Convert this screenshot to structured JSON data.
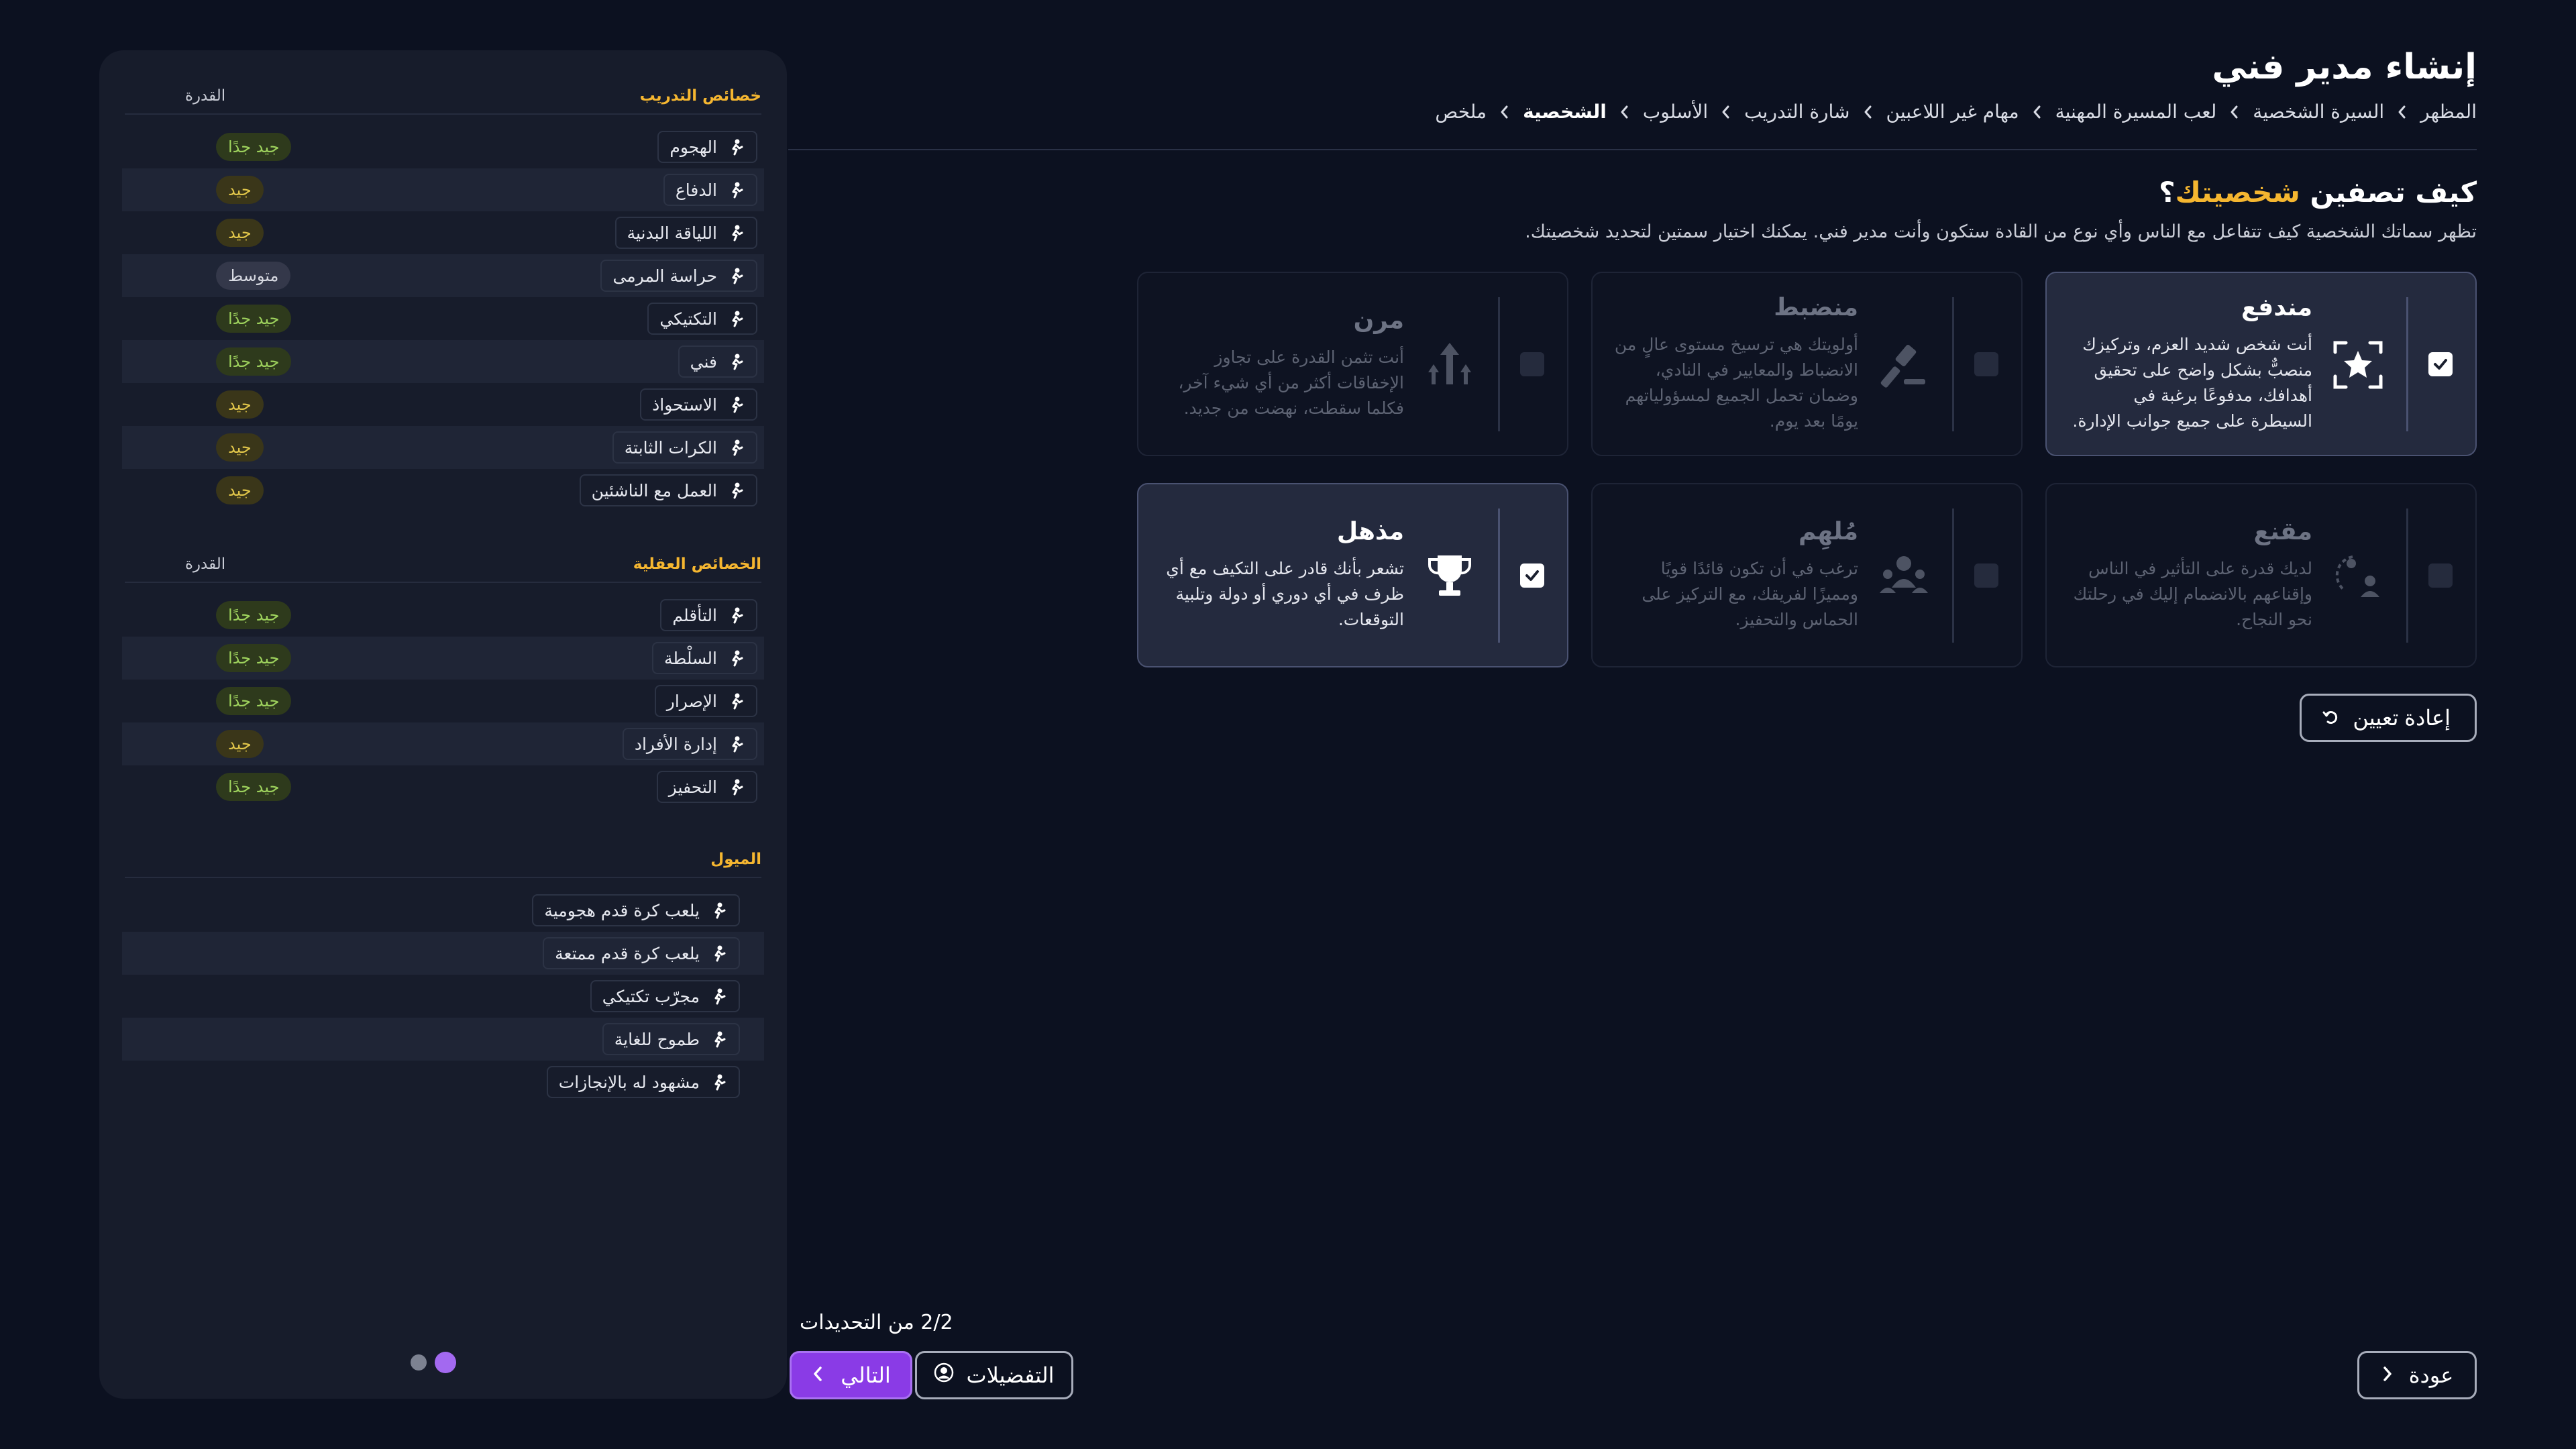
{
  "header": {
    "title": "إنشاء مدير فني",
    "breadcrumb": [
      "المظهر",
      "السيرة الشخصية",
      "لعب المسيرة المهنية",
      "مهام غير اللاعبين",
      "شارة التدريب",
      "الأسلوب",
      "الشخصية",
      "ملخص"
    ],
    "active_crumb": "الشخصية"
  },
  "question": {
    "prefix": "كيف تصفين ",
    "highlight": "شخصيتك",
    "suffix": "؟",
    "subtitle": "تظهر سماتك الشخصية كيف تتفاعل مع الناس وأي نوع من القادة ستكون وأنت مدير فني.   يمكنك اختيار سمتين لتحديد شخصيتك."
  },
  "traits": [
    {
      "title": "مندفع",
      "desc": "أنت شخص شديد العزم، وتركيزك منصبٌّ بشكل واضح على تحقيق أهدافك، مدفوعًا برغبة في السيطرة على جميع جوانب الإدارة.",
      "selected": true,
      "icon": "star-focus-icon"
    },
    {
      "title": "منضبط",
      "desc": "أولويتك هي ترسيخ مستوى عالٍ من الانضباط والمعايير في النادي، وضمان تحمل الجميع لمسؤولياتهم يومًا بعد يوم.",
      "selected": false,
      "icon": "gavel-icon"
    },
    {
      "title": "مرن",
      "desc": "أنت تثمن القدرة على تجاوز الإخفاقات أكثر من أي شيء آخر، فكلما سقطت، نهضت من جديد.",
      "selected": false,
      "icon": "arrows-up-icon"
    },
    {
      "title": "مقنع",
      "desc": "لديك قدرة على التأثير في الناس وإقناعهم بالانضمام إليك في رحلتك نحو النجاح.",
      "selected": false,
      "icon": "persuade-icon"
    },
    {
      "title": "مُلهِم",
      "desc": "ترغب في أن تكون قائدًا قويًا ومميزًا لفريقك، مع التركيز على الحماس والتحفيز.",
      "selected": false,
      "icon": "group-icon"
    },
    {
      "title": "مذهل",
      "desc": "تشعر بأنك قادر على التكيف مع أي ظرف في أي دوري أو دولة وتلبية التوقعات.",
      "selected": true,
      "icon": "trophy-icon"
    }
  ],
  "reset_label": "إعادة تعيين",
  "panel": {
    "training": {
      "title": "خصائص التدريب",
      "col": "القدرة",
      "items": [
        {
          "label": "الهجوم",
          "rating": "جيد جدًا",
          "level": "vgood",
          "icon": "attack-icon"
        },
        {
          "label": "الدفاع",
          "rating": "جيد",
          "level": "good",
          "icon": "defend-icon"
        },
        {
          "label": "اللياقة البدنية",
          "rating": "جيد",
          "level": "good",
          "icon": "fitness-icon"
        },
        {
          "label": "حراسة المرمى",
          "rating": "متوسط",
          "level": "avg",
          "icon": "goalkeeper-icon"
        },
        {
          "label": "التكتيكي",
          "rating": "جيد جدًا",
          "level": "vgood",
          "icon": "tactics-icon"
        },
        {
          "label": "فني",
          "rating": "جيد جدًا",
          "level": "vgood",
          "icon": "technical-icon"
        },
        {
          "label": "الاستحواذ",
          "rating": "جيد",
          "level": "good",
          "icon": "possession-icon"
        },
        {
          "label": "الكرات الثابتة",
          "rating": "جيد",
          "level": "good",
          "icon": "set-pieces-icon"
        },
        {
          "label": "العمل مع الناشئين",
          "rating": "جيد",
          "level": "good",
          "icon": "youth-star-icon"
        }
      ]
    },
    "mental": {
      "title": "الخصائص العقلية",
      "col": "القدرة",
      "items": [
        {
          "label": "التأقلم",
          "rating": "جيد جدًا",
          "level": "vgood",
          "icon": "adapt-icon"
        },
        {
          "label": "السلْطة",
          "rating": "جيد جدًا",
          "level": "vgood",
          "icon": "authority-icon"
        },
        {
          "label": "الإصرار",
          "rating": "جيد جدًا",
          "level": "vgood",
          "icon": "determination-icon"
        },
        {
          "label": "إدارة الأفراد",
          "rating": "جيد",
          "level": "good",
          "icon": "people-icon"
        },
        {
          "label": "التحفيز",
          "rating": "جيد جدًا",
          "level": "vgood",
          "icon": "motivation-icon"
        }
      ]
    },
    "tendencies": {
      "title": "الميول",
      "items": [
        {
          "label": "يلعب كرة قدم هجومية",
          "icon": "attacking-play-icon"
        },
        {
          "label": "يلعب كرة قدم ممتعة",
          "icon": "entertaining-play-icon"
        },
        {
          "label": "مجرّب تكتيكي",
          "icon": "tactical-experiment-icon"
        },
        {
          "label": "طموح للغاية",
          "icon": "ambitious-icon"
        },
        {
          "label": "مشهود له بالإنجازات",
          "icon": "achievements-icon"
        }
      ]
    }
  },
  "footer": {
    "updates": "2/2 من التحديدات",
    "next": "التالي",
    "prefs": "التفضيلات",
    "back": "عودة",
    "page_dots": 2,
    "active_dot": 2
  },
  "colors": {
    "accent": "#f5b630",
    "primary": "#8a3be6",
    "background": "#0c1120",
    "panel": "#171c2b",
    "rating_very_good": "#9ed25d",
    "rating_good": "#e1c64a"
  }
}
